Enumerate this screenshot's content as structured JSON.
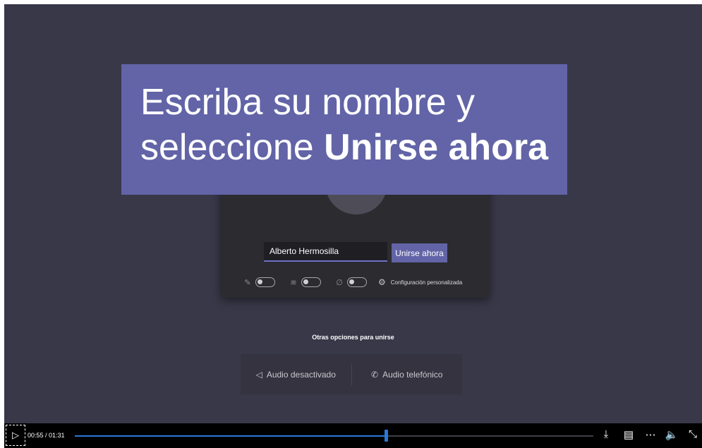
{
  "banner": {
    "line1": "Escriba su nombre y",
    "line2_prefix": "seleccione ",
    "line2_bold": "Unirse ahora"
  },
  "prejoin": {
    "name_value": "Alberto Hermosilla",
    "join_label": "Unirse ahora",
    "settings_label": "Configuración personalizada"
  },
  "other_options": {
    "title": "Otras opciones para unirse",
    "audio_off_label": "Audio desactivado",
    "phone_audio_label": "Audio telefónico"
  },
  "player": {
    "time": "00:55 / 01:31",
    "progress": 0.6
  },
  "colors": {
    "stage_bg": "#393849",
    "banner_bg": "#6264a7",
    "accent": "#6264a7",
    "progress": "#2c78d6"
  }
}
